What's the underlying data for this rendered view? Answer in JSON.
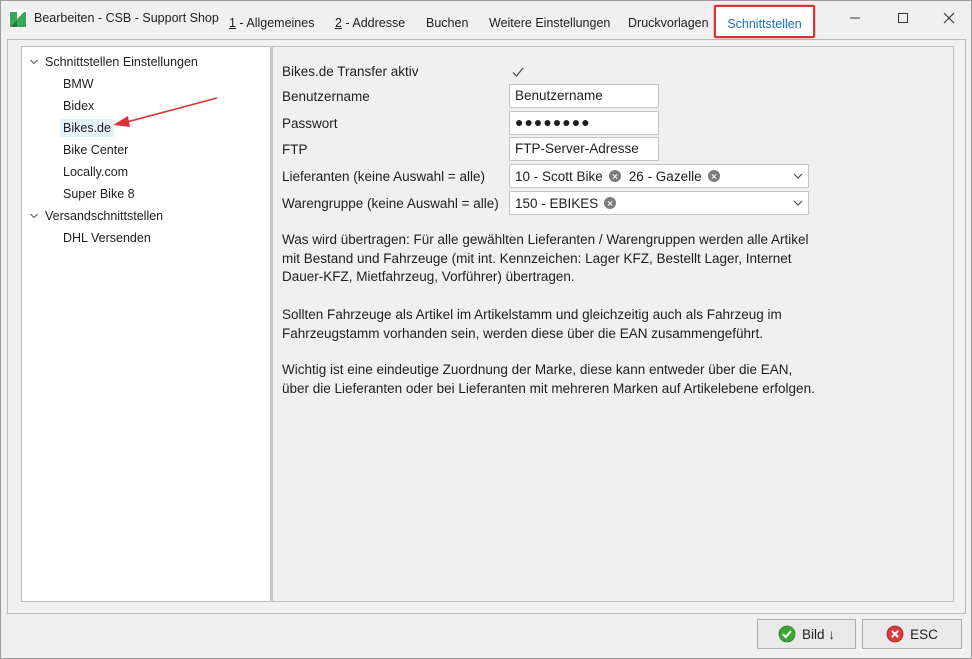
{
  "window": {
    "title": "Bearbeiten - CSB - Support Shop"
  },
  "tabs": [
    {
      "prefix": "1",
      "label": " - Allgemeines"
    },
    {
      "prefix": "2",
      "label": " - Addresse"
    },
    {
      "prefix": "",
      "label": "Buchen"
    },
    {
      "prefix": "",
      "label": "Weitere Einstellungen"
    },
    {
      "prefix": "",
      "label": "Druckvorlagen"
    },
    {
      "prefix": "",
      "label": "Schnittstellen",
      "active": true
    }
  ],
  "tree": {
    "groups": [
      {
        "label": "Schnittstellen Einstellungen",
        "items": [
          "BMW",
          "Bidex",
          "Bikes.de",
          "Bike Center",
          "Locally.com",
          "Super Bike 8"
        ]
      },
      {
        "label": "Versandschnittstellen",
        "items": [
          "DHL Versenden"
        ]
      }
    ],
    "selected": "Bikes.de"
  },
  "form": {
    "transfer_label": "Bikes.de Transfer aktiv",
    "transfer_checked": true,
    "username_label": "Benutzername",
    "username_value": "Benutzername",
    "password_label": "Passwort",
    "password_value": "●●●●●●●●",
    "ftp_label": "FTP",
    "ftp_value": "FTP-Server-Adresse",
    "suppliers_label": "Lieferanten (keine Auswahl = alle)",
    "suppliers": [
      "10 - Scott Bike",
      "26 - Gazelle"
    ],
    "groups_label": "Warengruppe (keine Auswahl = alle)",
    "product_groups": [
      "150 - EBIKES"
    ]
  },
  "info": {
    "p1": "Was wird übertragen: Für alle gewählten Lieferanten / Warengruppen werden alle Artikel mit Bestand und Fahrzeuge (mit int. Kennzeichen: Lager KFZ, Bestellt Lager, Internet Dauer-KFZ, Mietfahrzeug, Vorführer) übertragen.",
    "p2": "Sollten Fahrzeuge als Artikel im Artikelstamm und gleichzeitig auch als Fahrzeug im Fahrzeugstamm vorhanden sein, werden diese über die EAN zusammengeführt.",
    "p3": "Wichtig ist eine eindeutige Zuordnung der Marke, diese kann entweder über die EAN, über die Lieferanten oder bei Lieferanten mit mehreren Marken auf Artikelebene erfolgen."
  },
  "buttons": {
    "image_label": "Bild ↓",
    "esc_label": "ESC"
  },
  "colors": {
    "accent": "#1a6fc4",
    "highlight_box": "#d43535",
    "selection": "#e5f1fb",
    "ok_green": "#3fa535",
    "cancel_red": "#d93a3a"
  }
}
